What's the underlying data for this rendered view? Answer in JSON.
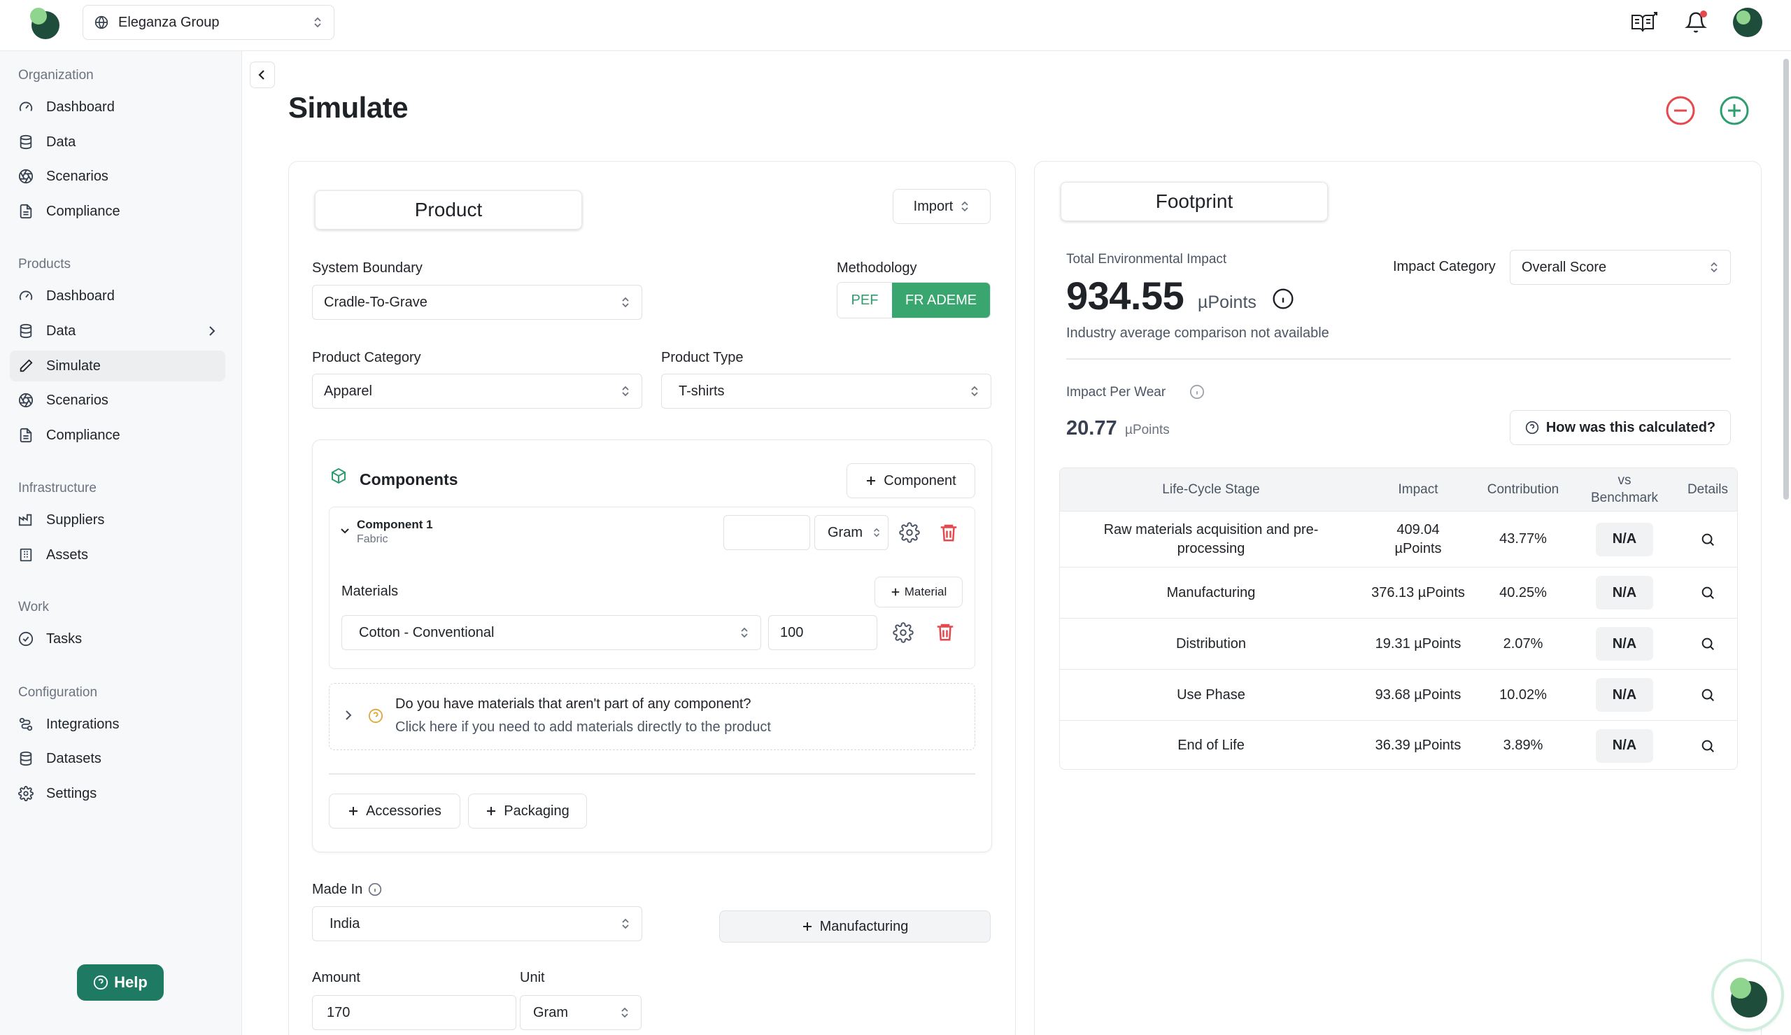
{
  "header": {
    "org_name": "Eleganza Group"
  },
  "sidebar": {
    "sections": [
      {
        "title": "Organization",
        "items": [
          "Dashboard",
          "Data",
          "Scenarios",
          "Compliance"
        ]
      },
      {
        "title": "Products",
        "items": [
          "Dashboard",
          "Data",
          "Simulate",
          "Scenarios",
          "Compliance"
        ]
      },
      {
        "title": "Infrastructure",
        "items": [
          "Suppliers",
          "Assets"
        ]
      },
      {
        "title": "Work",
        "items": [
          "Tasks"
        ]
      },
      {
        "title": "Configuration",
        "items": [
          "Integrations",
          "Datasets",
          "Settings"
        ]
      }
    ],
    "active_item": "Simulate",
    "help_label": "Help"
  },
  "page": {
    "title": "Simulate"
  },
  "product": {
    "tab_label": "Product",
    "import_label": "Import",
    "system_boundary_label": "System Boundary",
    "system_boundary_value": "Cradle-To-Grave",
    "methodology_label": "Methodology",
    "methodology_options": [
      "PEF",
      "FR ADEME"
    ],
    "methodology_selected": "FR ADEME",
    "category_label": "Product Category",
    "category_value": "Apparel",
    "type_label": "Product Type",
    "type_value": "T-shirts",
    "components_title": "Components",
    "add_component_label": "Component",
    "component_name": "Component 1",
    "component_subtitle": "Fabric",
    "component_weight": "",
    "component_unit": "Gram",
    "materials_label": "Materials",
    "add_material_label": "Material",
    "material_value": "Cotton - Conventional",
    "material_amount": "100",
    "loose_title": "Do you have materials that aren't part of any component?",
    "loose_subtitle": "Click here if you need to add materials directly to the product",
    "accessories_label": "Accessories",
    "packaging_label": "Packaging",
    "made_in_label": "Made In",
    "made_in_value": "India",
    "manufacturing_label": "Manufacturing",
    "amount_label": "Amount",
    "amount_value": "170",
    "unit_label": "Unit",
    "unit_value": "Gram"
  },
  "footprint": {
    "tab_label": "Footprint",
    "total_label": "Total Environmental Impact",
    "total_value": "934.55",
    "total_unit": "µPoints",
    "industry_note": "Industry average comparison not available",
    "impact_category_label": "Impact Category",
    "impact_category_value": "Overall Score",
    "per_wear_label": "Impact Per Wear",
    "per_wear_value": "20.77",
    "per_wear_unit": "µPoints",
    "how_calculated_label": "How was this calculated?",
    "table": {
      "headers": [
        "Life-Cycle Stage",
        "Impact",
        "Contribution",
        "vs Benchmark",
        "Details"
      ],
      "rows": [
        {
          "stage": "Raw materials acquisition and pre-processing",
          "impact": "409.04 µPoints",
          "contribution": "43.77%",
          "benchmark": "N/A"
        },
        {
          "stage": "Manufacturing",
          "impact": "376.13 µPoints",
          "contribution": "40.25%",
          "benchmark": "N/A"
        },
        {
          "stage": "Distribution",
          "impact": "19.31 µPoints",
          "contribution": "2.07%",
          "benchmark": "N/A"
        },
        {
          "stage": "Use Phase",
          "impact": "93.68 µPoints",
          "contribution": "10.02%",
          "benchmark": "N/A"
        },
        {
          "stage": "End of Life",
          "impact": "36.39 µPoints",
          "contribution": "3.89%",
          "benchmark": "N/A"
        }
      ]
    }
  },
  "colors": {
    "brand": "#1f7a63",
    "accent_green": "#3aa66f",
    "danger": "#e5484d"
  }
}
